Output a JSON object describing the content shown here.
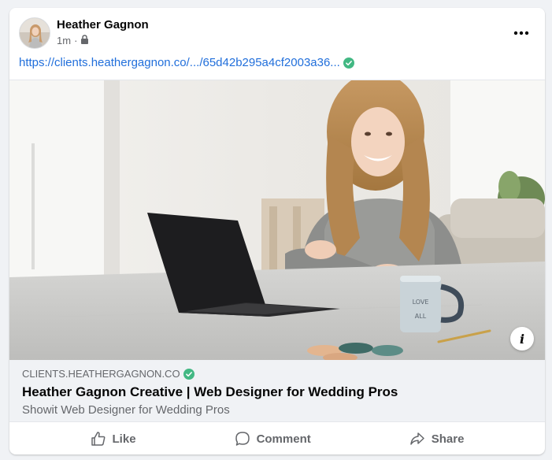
{
  "post": {
    "author": "Heather Gagnon",
    "time": "1m",
    "separator": "·",
    "privacy_icon": "lock-icon",
    "more_icon": "more-horizontal-icon",
    "link_text": "https://clients.heathergagnon.co/.../65d42b295a4cf2003a36...",
    "verified_color": "#42b883"
  },
  "preview": {
    "domain": "CLIENTS.HEATHERGAGNON.CO",
    "title": "Heather Gagnon Creative | Web Designer for Wedding Pros",
    "description": "Showit Web Designer for Wedding Pros",
    "info_label": "i",
    "mug_text_1": "LOVE",
    "mug_text_2": "ALL"
  },
  "actions": {
    "like": "Like",
    "comment": "Comment",
    "share": "Share"
  },
  "colors": {
    "link": "#216fdb",
    "secondary_text": "#65676b",
    "background": "#f0f2f5"
  }
}
